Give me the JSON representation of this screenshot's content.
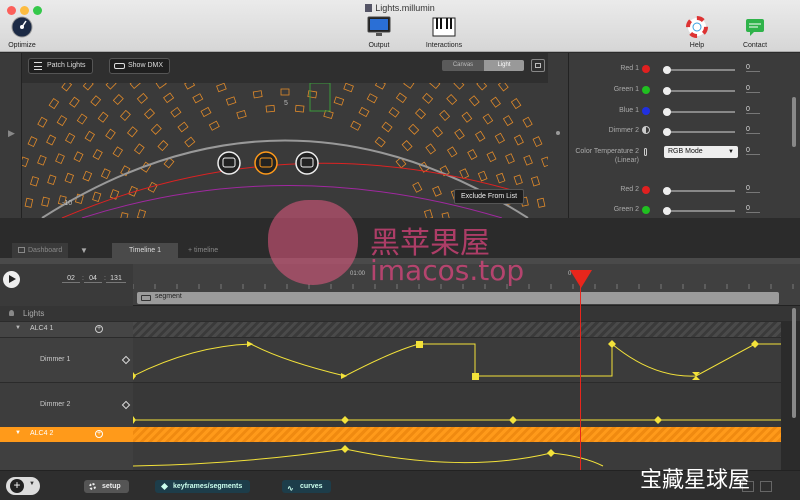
{
  "window": {
    "title": "Lights.millumin"
  },
  "toolbar": {
    "optimize": "Optimize",
    "output": "Output",
    "interactions": "Interactions",
    "help": "Help",
    "contact": "Contact"
  },
  "stage": {
    "patch_lights": "Patch Lights",
    "show_dmx": "Show DMX",
    "view_canvas": "Canvas",
    "view_light": "Light",
    "exclude_label": "Exclude From List",
    "marker_5": "5",
    "marker_neg10": "-10"
  },
  "params": [
    {
      "label": "Red 1",
      "value": "0",
      "color": "#e02020"
    },
    {
      "label": "Green 1",
      "value": "0",
      "color": "#20c020"
    },
    {
      "label": "Blue 1",
      "value": "0",
      "color": "#2030e0"
    },
    {
      "label": "Dimmer 2",
      "value": "0"
    },
    {
      "label": "Color Temperature 2 (Linear)",
      "value": "0",
      "mode": "RGB Mode"
    },
    {
      "label": "Red 2",
      "value": "0",
      "color": "#e02020"
    },
    {
      "label": "Green 2",
      "value": "0",
      "color": "#20c020"
    }
  ],
  "tabs": {
    "dashboard": "Dashboard",
    "timeline1": "Timeline 1",
    "add_timeline": "+ timeline"
  },
  "transport": {
    "min": "02",
    "sec": "04",
    "frame": "131"
  },
  "ruler": {
    "mark1": "01:00",
    "mark2": "0"
  },
  "segment_label": "segment",
  "tracks": {
    "section": "Lights",
    "alc1": "ALC4  1",
    "dimmer1": "Dimmer 1",
    "dimmer2": "Dimmer 2",
    "alc2": "ALC4  2"
  },
  "bottom": {
    "setup": "setup",
    "keyframes": "keyframes/segments",
    "curves": "curves"
  },
  "watermark": {
    "cn": "黑苹果屋",
    "site": "imacos.top",
    "corner": "宝藏星球屋"
  },
  "colors": {
    "accent": "#ff9a1a",
    "playhead": "#e8261c",
    "curve": "#f3e23a"
  }
}
